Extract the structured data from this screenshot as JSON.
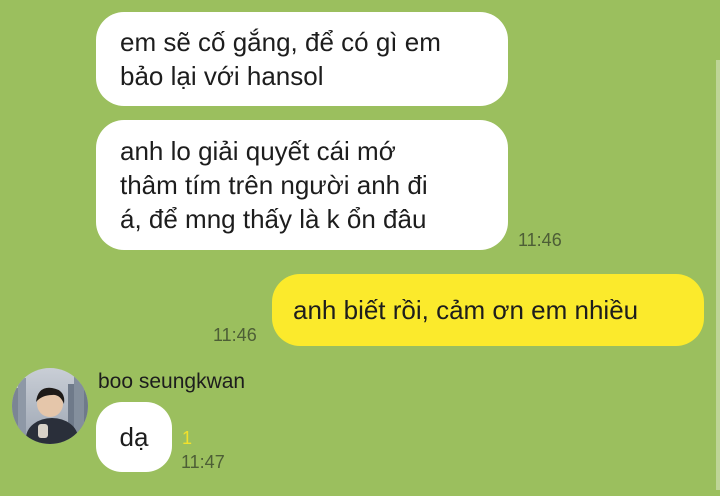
{
  "chat": {
    "messages": [
      {
        "text": "em sẽ cố gắng, để có gì em\nbảo lại với hansol"
      },
      {
        "text": "anh lo giải quyết cái mớ\nthâm tím trên người anh đi\ná, để mng thấy là k ổn đâu",
        "time": "11:46"
      },
      {
        "text": "anh biết rồi, cảm ơn em nhiều",
        "time": "11:46"
      },
      {
        "sender": "boo seungkwan",
        "text": "dạ",
        "unread": "1",
        "time": "11:47"
      }
    ]
  },
  "colors": {
    "background": "#9bbf5e",
    "incoming_bubble": "#ffffff",
    "outgoing_bubble": "#fbea2c",
    "unread_count": "#f3e12a"
  },
  "icons": {
    "avatar": "profile-photo"
  }
}
